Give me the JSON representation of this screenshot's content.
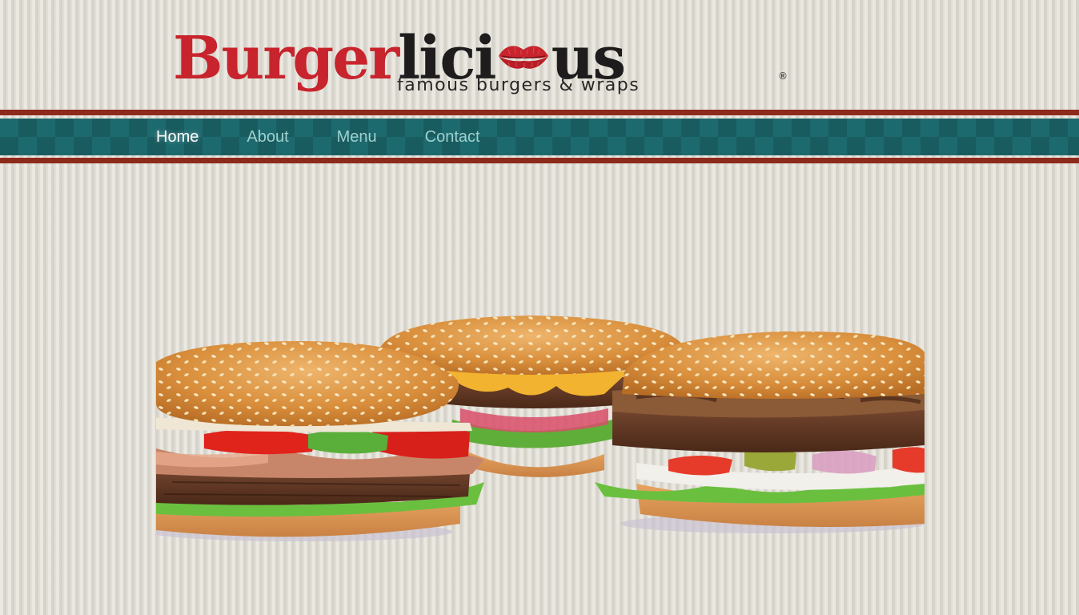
{
  "brand": {
    "name_part1": "Burger",
    "name_part2": "lici",
    "name_part3": "us",
    "tagline": "famous burgers & wraps",
    "registered_mark": "®",
    "lips_icon": "lips-kiss-icon",
    "colors": {
      "red": "#c8242d",
      "dark": "#1e1c1c"
    }
  },
  "nav": {
    "items": [
      {
        "label": "Home",
        "active": true
      },
      {
        "label": "About",
        "active": false
      },
      {
        "label": "Menu",
        "active": false
      },
      {
        "label": "Contact",
        "active": false
      }
    ],
    "colors": {
      "band": "#1d6a6e",
      "stripe": "#8e2a1c",
      "link": "#9fd0cf",
      "active_link": "#ffffff"
    }
  },
  "hero": {
    "image": "three-burgers-photo"
  }
}
